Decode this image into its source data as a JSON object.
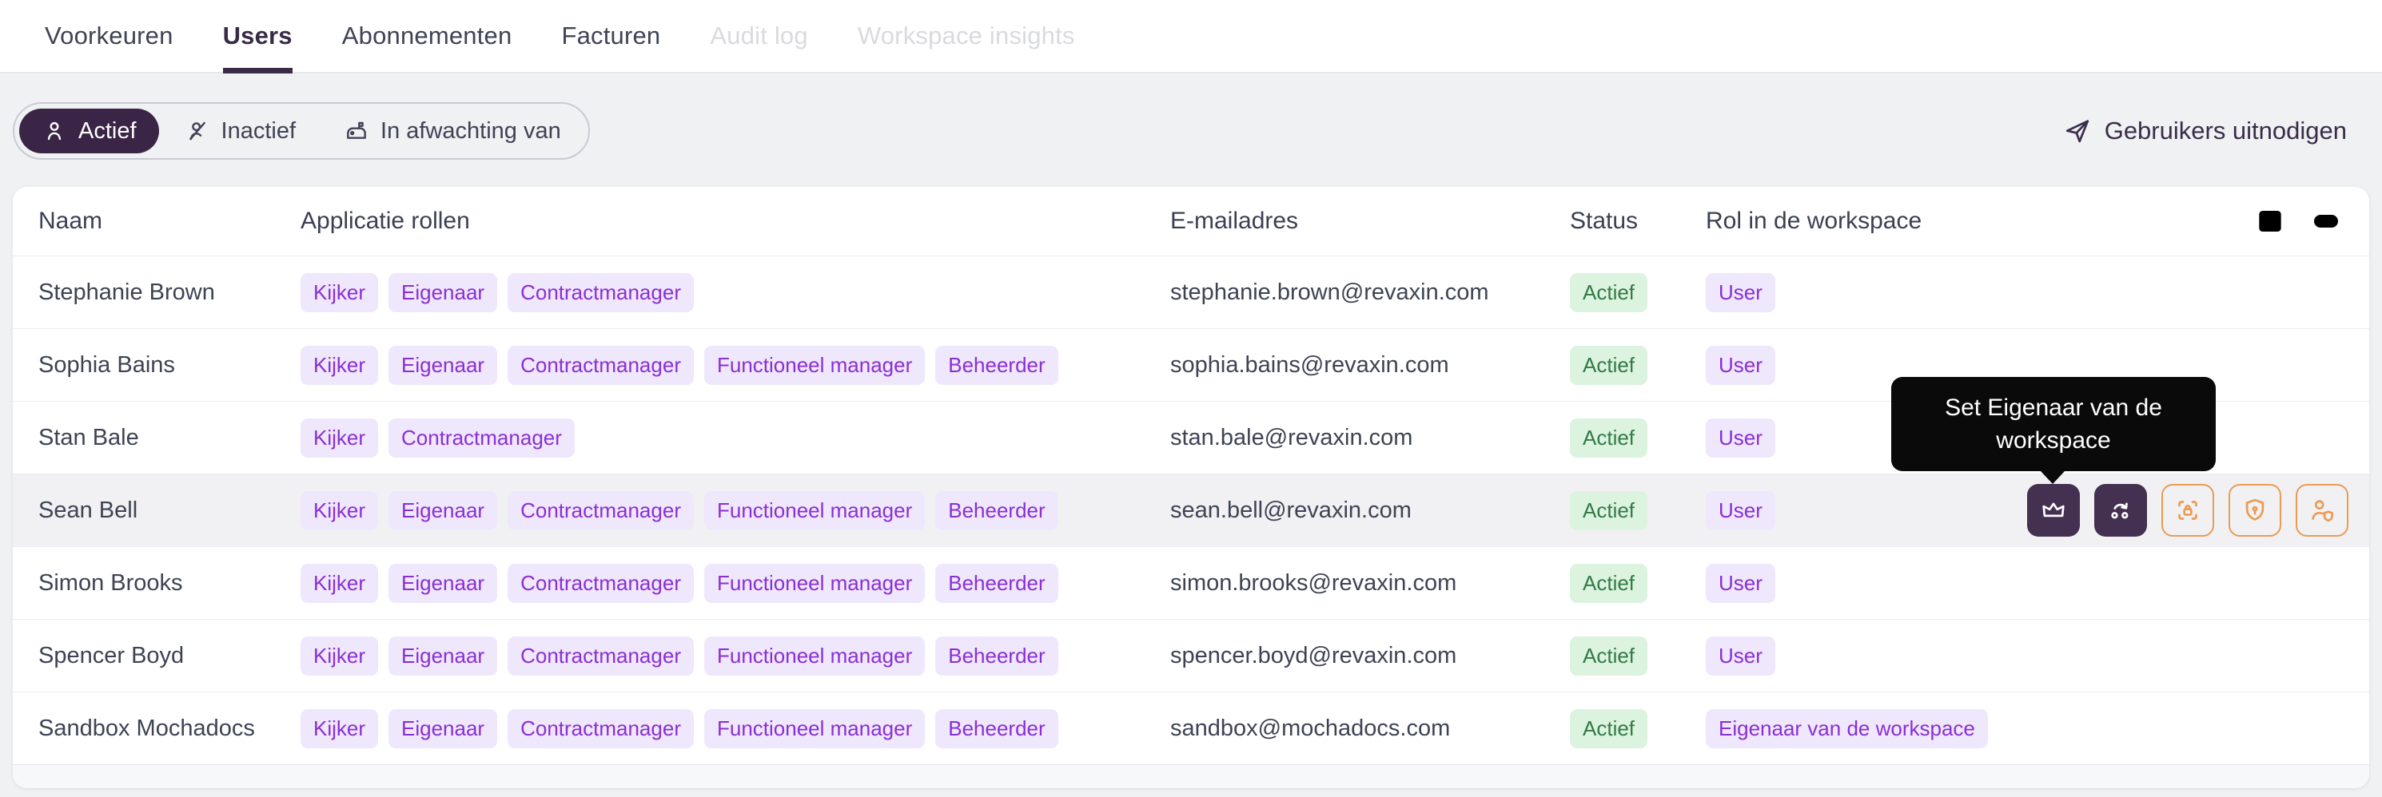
{
  "nav": {
    "items": [
      {
        "label": "Voorkeuren",
        "state": "default"
      },
      {
        "label": "Users",
        "state": "active"
      },
      {
        "label": "Abonnementen",
        "state": "default"
      },
      {
        "label": "Facturen",
        "state": "default"
      },
      {
        "label": "Audit log",
        "state": "disabled"
      },
      {
        "label": "Workspace insights",
        "state": "disabled"
      }
    ]
  },
  "filters": {
    "tabs": [
      {
        "label": "Actief",
        "icon": "i-user",
        "active": true
      },
      {
        "label": "Inactief",
        "icon": "i-user-slash",
        "active": false
      },
      {
        "label": "In afwachting van",
        "icon": "i-mailbox",
        "active": false
      }
    ],
    "invite_button": {
      "label": "Gebruikers uitnodigen",
      "icon": "send-icon"
    }
  },
  "table": {
    "columns": {
      "name": "Naam",
      "roles": "Applicatie rollen",
      "email": "E-mailadres",
      "status": "Status",
      "workspace_role": "Rol in de workspace"
    },
    "header_icons": [
      "columns-icon",
      "toggle-icon"
    ],
    "rows": [
      {
        "name": "Stephanie Brown",
        "roles": [
          "Kijker",
          "Eigenaar",
          "Contractmanager"
        ],
        "email": "stephanie.brown@revaxin.com",
        "status": "Actief",
        "workspace_role": "User",
        "hovered": false
      },
      {
        "name": "Sophia Bains",
        "roles": [
          "Kijker",
          "Eigenaar",
          "Contractmanager",
          "Functioneel manager",
          "Beheerder"
        ],
        "email": "sophia.bains@revaxin.com",
        "status": "Actief",
        "workspace_role": "User",
        "hovered": false
      },
      {
        "name": "Stan Bale",
        "roles": [
          "Kijker",
          "Contractmanager"
        ],
        "email": "stan.bale@revaxin.com",
        "status": "Actief",
        "workspace_role": "User",
        "hovered": false
      },
      {
        "name": "Sean Bell",
        "roles": [
          "Kijker",
          "Eigenaar",
          "Contractmanager",
          "Functioneel manager",
          "Beheerder"
        ],
        "email": "sean.bell@revaxin.com",
        "status": "Actief",
        "workspace_role": "User",
        "hovered": true
      },
      {
        "name": "Simon Brooks",
        "roles": [
          "Kijker",
          "Eigenaar",
          "Contractmanager",
          "Functioneel manager",
          "Beheerder"
        ],
        "email": "simon.brooks@revaxin.com",
        "status": "Actief",
        "workspace_role": "User",
        "hovered": false
      },
      {
        "name": "Spencer Boyd",
        "roles": [
          "Kijker",
          "Eigenaar",
          "Contractmanager",
          "Functioneel manager",
          "Beheerder"
        ],
        "email": "spencer.boyd@revaxin.com",
        "status": "Actief",
        "workspace_role": "User",
        "hovered": false
      },
      {
        "name": "Sandbox Mochadocs",
        "roles": [
          "Kijker",
          "Eigenaar",
          "Contractmanager",
          "Functioneel manager",
          "Beheerder"
        ],
        "email": "sandbox@mochadocs.com",
        "status": "Actief",
        "workspace_role": "Eigenaar van de workspace",
        "hovered": false
      }
    ]
  },
  "row_actions": [
    {
      "name": "set-workspace-owner-button",
      "icon": "i-crown",
      "style": "dark"
    },
    {
      "name": "transfer-button",
      "icon": "i-swap",
      "style": "dark"
    },
    {
      "name": "lock-user-button",
      "icon": "i-lock-scan",
      "style": "orange"
    },
    {
      "name": "security-button",
      "icon": "i-shield",
      "style": "orange"
    },
    {
      "name": "user-permissions-button",
      "icon": "i-user-shield",
      "style": "orange"
    }
  ],
  "tooltip": {
    "text": "Set Eigenaar van de workspace"
  },
  "colors": {
    "brand_dark_purple": "#3a2546",
    "badge_purple_bg": "#efe7fc",
    "badge_purple_text": "#8a2fd4",
    "status_green_bg": "#dcf3e0",
    "status_green_text": "#327a45",
    "action_orange": "#eb9b53",
    "action_dark": "#443051",
    "tooltip_bg": "#0a0a0b",
    "page_bg": "#f0f1f3"
  }
}
